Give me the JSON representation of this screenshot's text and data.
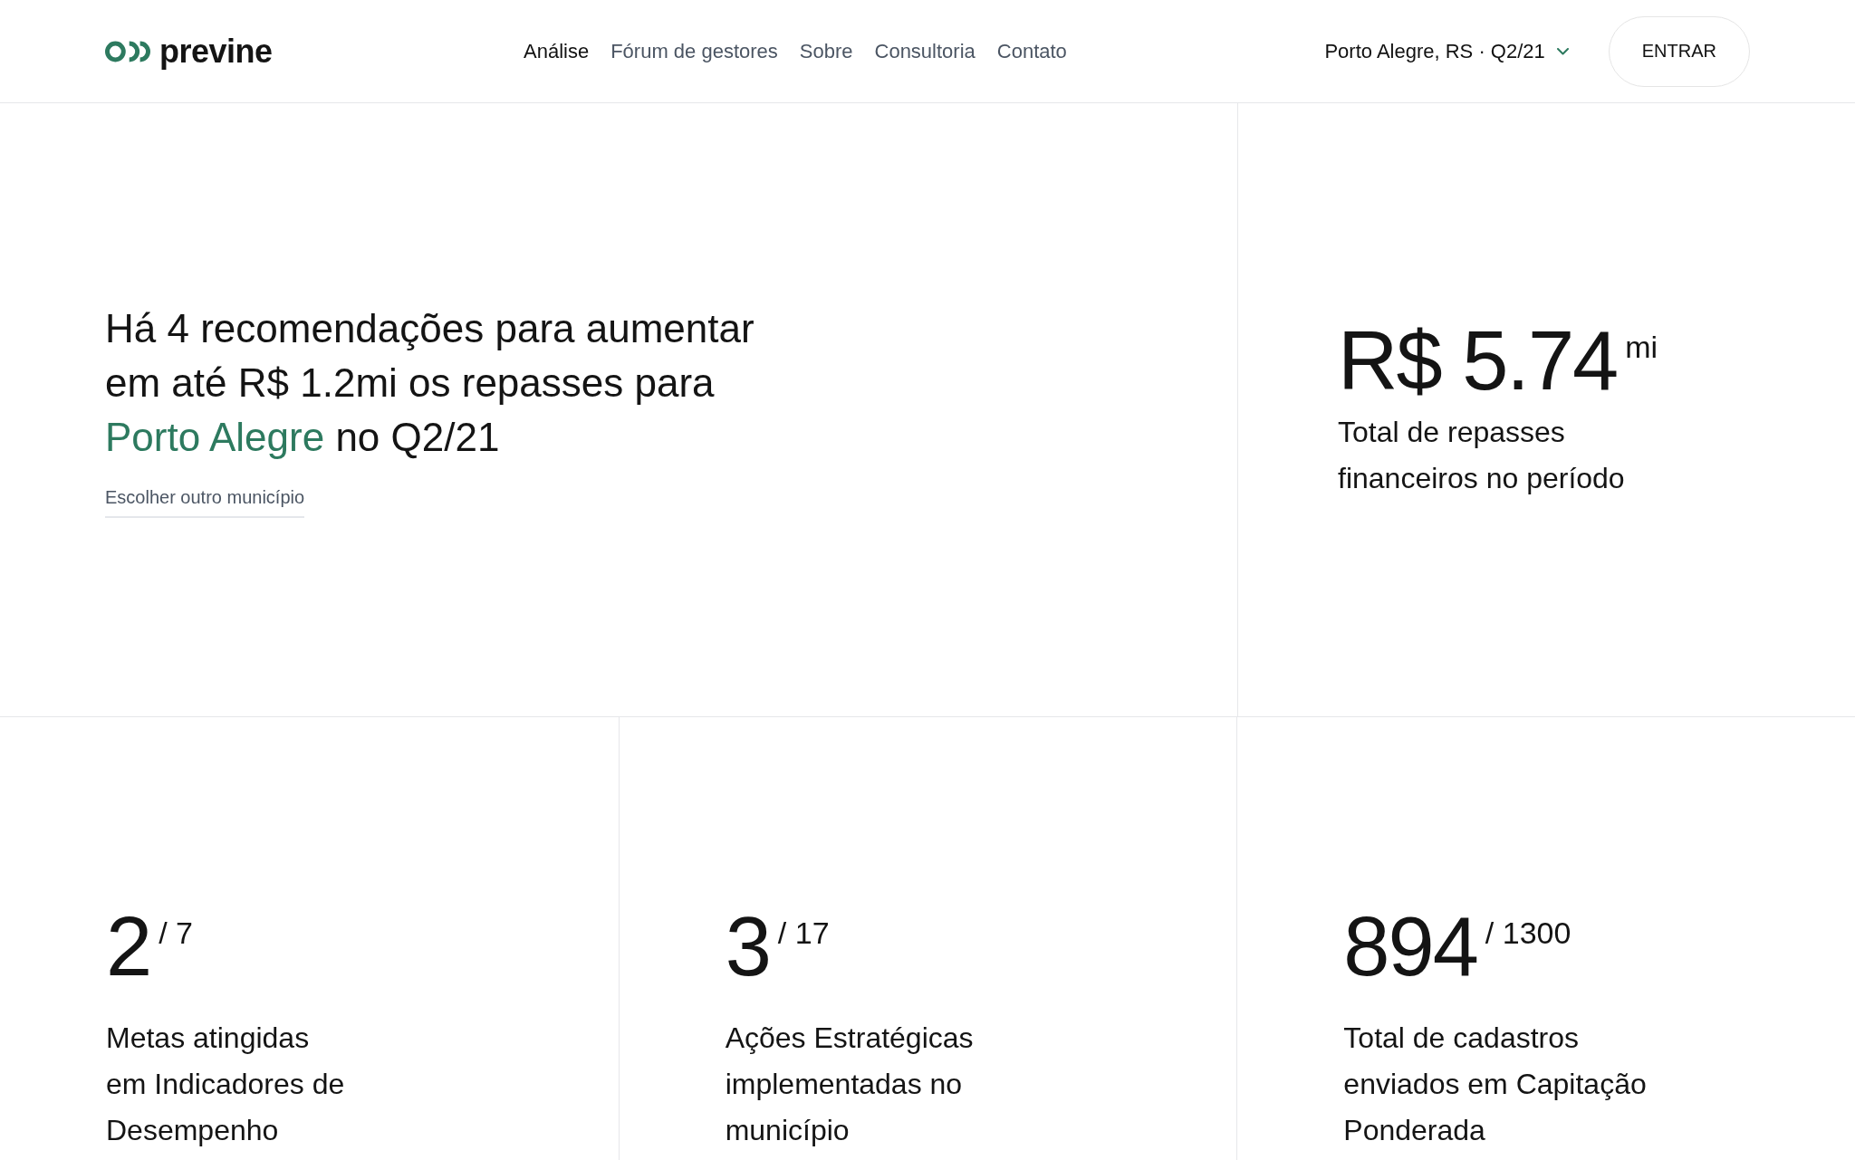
{
  "header": {
    "logo": {
      "text": "previne"
    },
    "nav": [
      {
        "label": "Análise",
        "selected": true
      },
      {
        "label": "Fórum de gestores",
        "selected": false
      },
      {
        "label": "Sobre",
        "selected": false
      },
      {
        "label": "Consultoria",
        "selected": false
      },
      {
        "label": "Contato",
        "selected": false
      }
    ],
    "location_selector": {
      "value": "Porto Alegre, RS · Q2/21"
    },
    "login_button": {
      "label": "ENTRAR"
    }
  },
  "hero": {
    "headline": {
      "before": "Há 4 recomendações para aumentar\nem até R$ 1.2mi os repasses para\n",
      "highlight": "Porto Alegre",
      "after": " no Q2/21"
    },
    "link": "Escolher outro município"
  },
  "total_card": {
    "value": "R$ 5.74",
    "unit": "mi",
    "label": "Total de repasses\nfinanceiros no período"
  },
  "stats": [
    {
      "value": "2",
      "total": "/ 7",
      "label": "Metas atingidas\nem Indicadores de\nDesempenho"
    },
    {
      "value": "3",
      "total": "/ 17",
      "label": "Ações Estratégicas\nimplementadas no\nmunicípio"
    },
    {
      "value": "894",
      "total": "/ 1300",
      "label": "Total de cadastros\nenviados em Capitação\nPonderada"
    }
  ]
}
